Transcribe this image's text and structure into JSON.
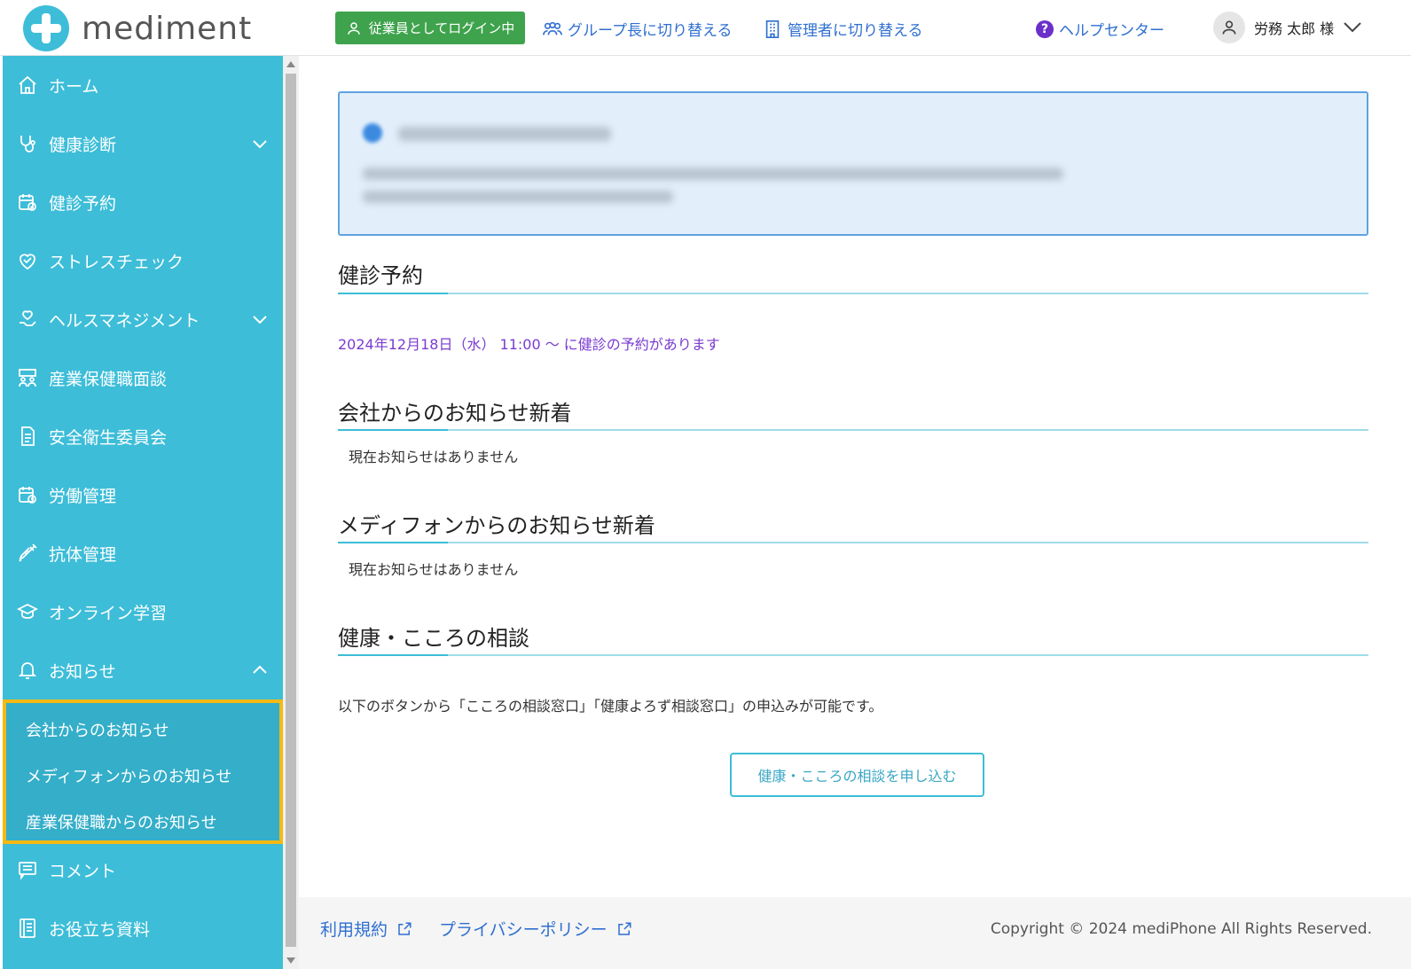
{
  "header": {
    "logo_text": "mediment",
    "employee_badge": "従業員としてログイン中",
    "switch_group_leader": "グループ長に切り替える",
    "switch_admin": "管理者に切り替える",
    "help_center": "ヘルプセンター",
    "user_name": "労務 太郎 様"
  },
  "sidebar": {
    "items": [
      {
        "label": "ホーム",
        "icon": "home-icon"
      },
      {
        "label": "健康診断",
        "icon": "stethoscope-icon"
      },
      {
        "label": "健診予約",
        "icon": "calendar-check-icon"
      },
      {
        "label": "ストレスチェック",
        "icon": "heart-icon"
      },
      {
        "label": "ヘルスマネジメント",
        "icon": "health-management-icon"
      },
      {
        "label": "産業保健職面談",
        "icon": "meeting-icon"
      },
      {
        "label": "安全衛生委員会",
        "icon": "document-icon"
      },
      {
        "label": "労働管理",
        "icon": "calendar-clock-icon"
      },
      {
        "label": "抗体管理",
        "icon": "syringe-icon"
      },
      {
        "label": "オンライン学習",
        "icon": "graduation-cap-icon"
      },
      {
        "label": "お知らせ",
        "icon": "bell-icon"
      },
      {
        "label": "コメント",
        "icon": "comment-icon"
      },
      {
        "label": "お役立ち資料",
        "icon": "book-icon"
      }
    ],
    "submenu": [
      "会社からのお知らせ",
      "メディフォンからのお知らせ",
      "産業保健職からのお知らせ"
    ]
  },
  "main": {
    "sections": {
      "reservation_title": "健診予約",
      "reservation_text": "2024年12月18日（水） 11:00 ～ に健診の予約があります",
      "company_news_title": "会社からのお知らせ新着",
      "company_news_empty": "現在お知らせはありません",
      "mediphone_news_title": "メディフォンからのお知らせ新着",
      "mediphone_news_empty": "現在お知らせはありません",
      "consult_title": "健康・こころの相談",
      "consult_text": "以下のボタンから「こころの相談窓口」「健康よろず相談窓口」の申込みが可能です。",
      "consult_button": "健康・こころの相談を申し込む"
    }
  },
  "footer": {
    "terms": "利用規約",
    "privacy": "プライバシーポリシー",
    "copyright": "Copyright © 2024 mediPhone All Rights Reserved."
  },
  "colors": {
    "sidebar": "#3dbdd8",
    "accent_green": "#3fa34d",
    "link_blue": "#2f6fd0",
    "highlight": "#f5b912",
    "appointment_purple": "#7a3bd1"
  }
}
